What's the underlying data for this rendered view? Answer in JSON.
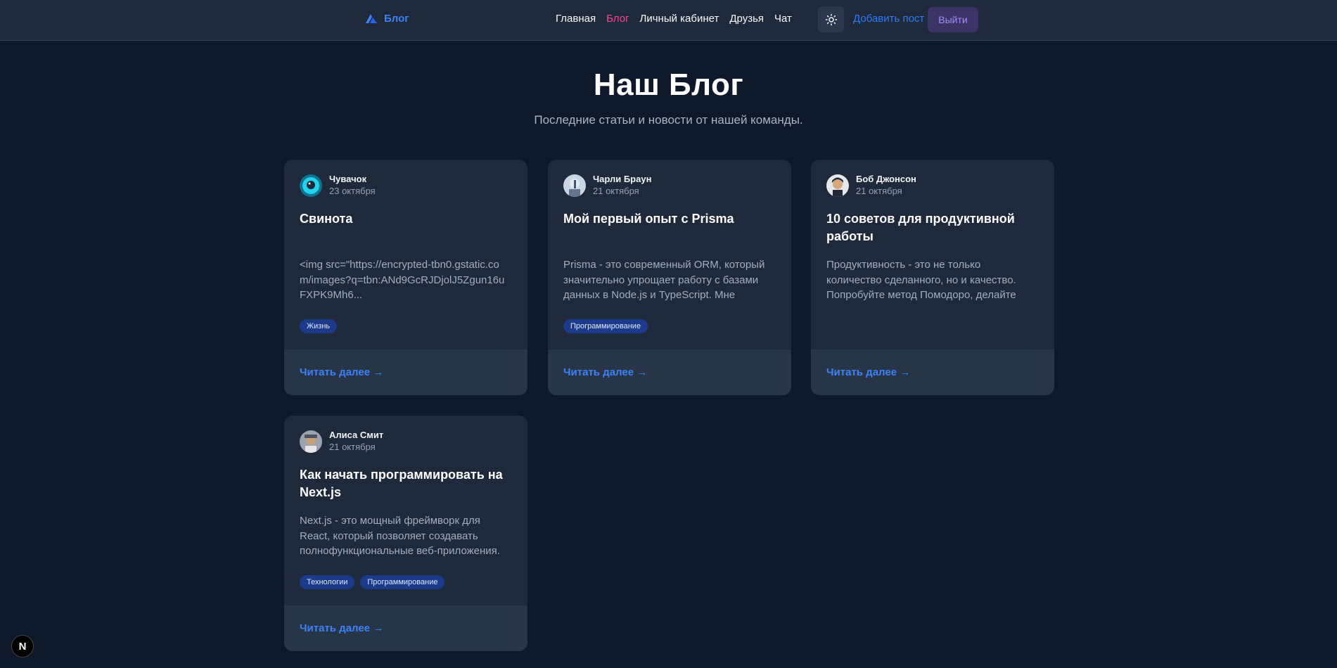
{
  "header": {
    "brand": "Блог",
    "nav": [
      "Главная",
      "Блог",
      "Личный кабинет",
      "Друзья",
      "Чат"
    ],
    "active_nav": "Блог",
    "add_post": "Добавить пост",
    "logout": "Выйти",
    "theme_icon": "sun-icon"
  },
  "hero": {
    "title": "Наш Блог",
    "subtitle": "Последние статьи и новости от нашей команды."
  },
  "posts": [
    {
      "author": "Чувачок",
      "date": "23 октября",
      "title": "Свинота",
      "excerpt": "<img src=\"https://encrypted-tbn0.gstatic.com/images?q=tbn:ANd9GcRJDjolJ5Zgun16uFXPK9Mh6...",
      "tags": [
        "Жизнь"
      ],
      "read_more": "Читать далее →"
    },
    {
      "author": "Чарли Браун",
      "date": "21 октября",
      "title": "Мой первый опыт с Prisma",
      "excerpt": "Prisma - это современный ORM, который значительно упрощает работу с базами данных в Node.js и TypeScript. Мне очень...",
      "tags": [
        "Программирование"
      ],
      "read_more": "Читать далее →"
    },
    {
      "author": "Боб Джонсон",
      "date": "21 октября",
      "title": "10 советов для продуктивной работы",
      "excerpt": "Продуктивность - это не только количество сделанного, но и качество. Попробуйте метод Помодоро, делайте перерывы и не...",
      "tags": [],
      "read_more": "Читать далее →"
    },
    {
      "author": "Алиса Смит",
      "date": "21 октября",
      "title": "Как начать программировать на Next.js",
      "excerpt": "Next.js - это мощный фреймворк для React, который позволяет создавать полнофункциональные веб-приложения. Начните с установки Node.js и затем...",
      "tags": [
        "Технологии",
        "Программирование"
      ],
      "read_more": "Читать далее →"
    }
  ],
  "next_badge": "N"
}
